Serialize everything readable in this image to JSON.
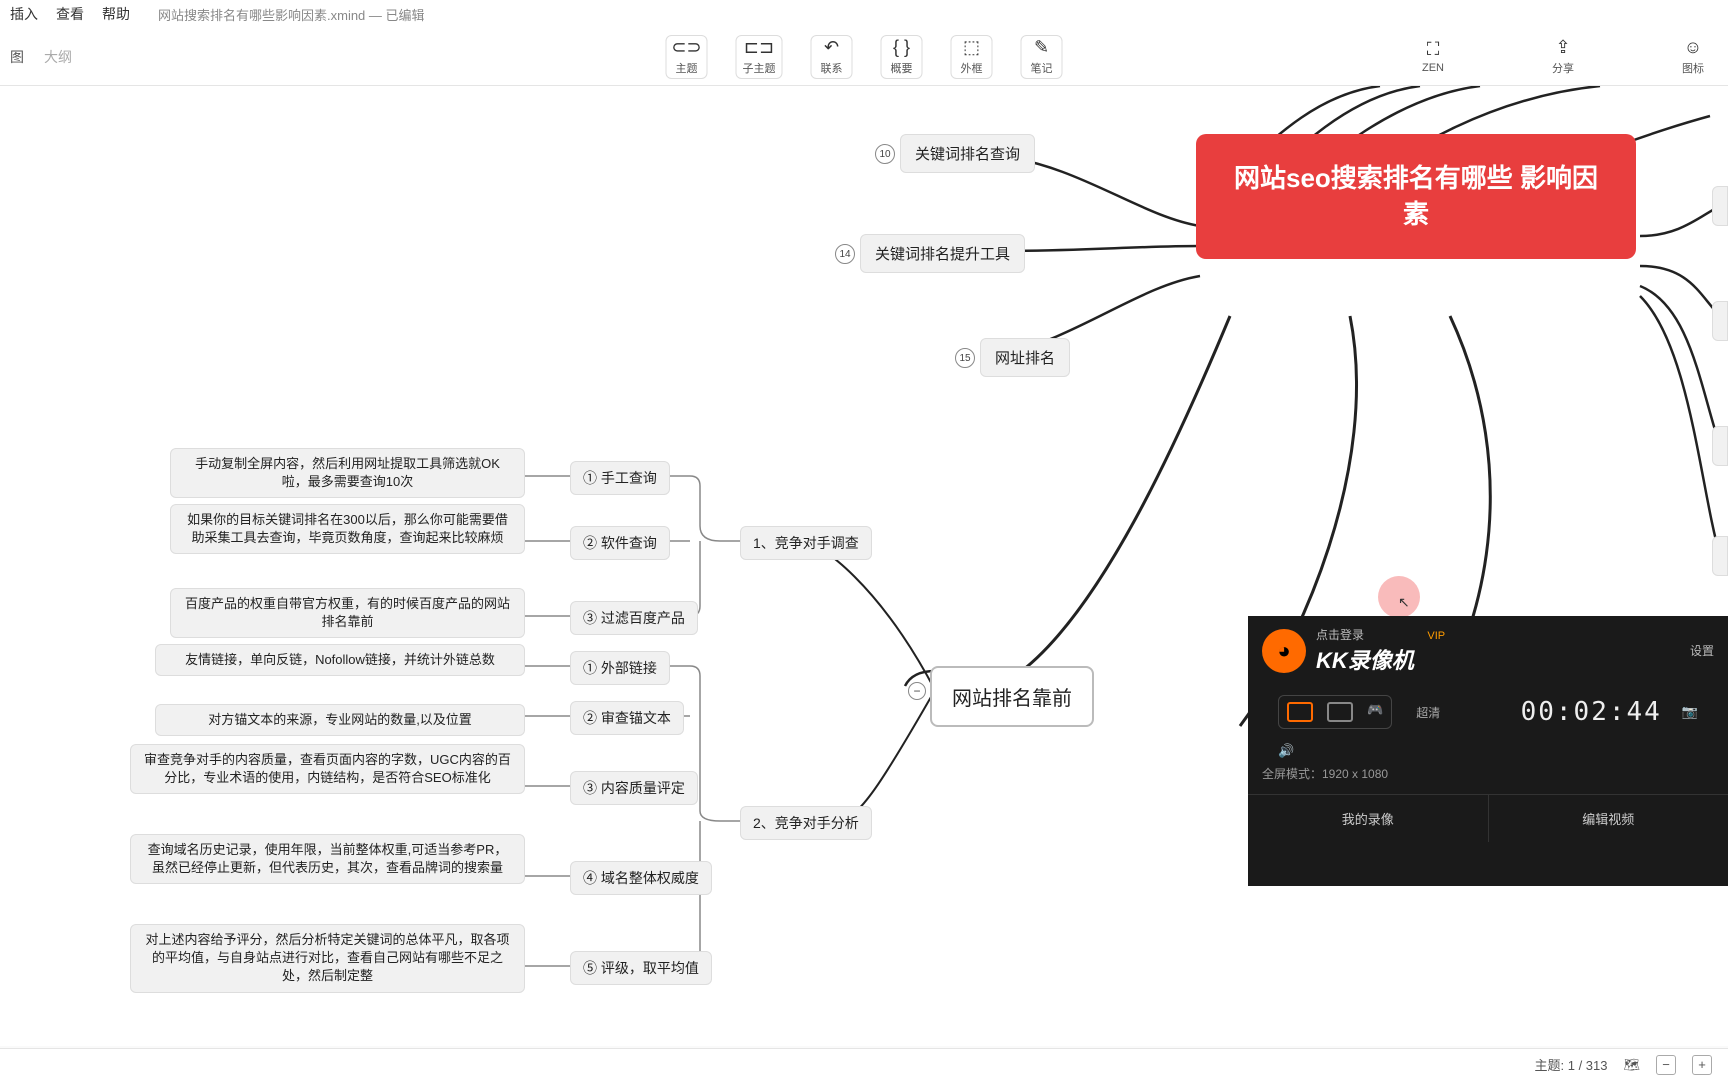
{
  "menu": {
    "items": [
      "插入",
      "查看",
      "帮助"
    ],
    "filename": "网站搜索排名有哪些影响因素.xmind",
    "status": "已编辑"
  },
  "tabs": {
    "graph": "图",
    "outline": "大纲"
  },
  "toolbar": {
    "topic": "主题",
    "subtopic": "子主题",
    "relation": "联系",
    "summary": "概要",
    "boundary": "外框",
    "note": "笔记",
    "zen": "ZEN",
    "share": "分享",
    "icon": "图标"
  },
  "root": "网站seo搜索排名有哪些\n影响因素",
  "sub_main": "网站排名靠前",
  "upper_nodes": [
    {
      "num": "10",
      "label": "关键词排名查询"
    },
    {
      "num": "14",
      "label": "关键词排名提升工具"
    },
    {
      "num": "15",
      "label": "网址排名"
    }
  ],
  "mid_a": {
    "label": "1、竞争对手调查",
    "children": [
      {
        "idx": "① 手工查询",
        "desc": "手动复制全屏内容，然后利用网址提取工具筛选就OK啦，最多需要查询10次"
      },
      {
        "idx": "② 软件查询",
        "desc": "如果你的目标关键词排名在300以后，那么你可能需要借助采集工具去查询，毕竟页数角度，查询起来比较麻烦"
      },
      {
        "idx": "③ 过滤百度产品",
        "desc": "百度产品的权重自带官方权重，有的时候百度产品的网站排名靠前"
      }
    ]
  },
  "mid_b": {
    "label": "2、竞争对手分析",
    "children": [
      {
        "idx": "① 外部链接",
        "desc": "友情链接，单向反链，Nofollow链接，并统计外链总数"
      },
      {
        "idx": "② 审查锚文本",
        "desc": "对方锚文本的来源，专业网站的数量,以及位置"
      },
      {
        "idx": "③ 内容质量评定",
        "desc": "审查竞争对手的内容质量，查看页面内容的字数，UGC内容的百分比，专业术语的使用，内链结构，是否符合SEO标准化"
      },
      {
        "idx": "④ 域名整体权威度",
        "desc": "查询域名历史记录，使用年限，当前整体权重,可适当参考PR，虽然已经停止更新，但代表历史，其次，查看品牌词的搜索量"
      },
      {
        "idx": "⑤ 评级，取平均值",
        "desc": "对上述内容给予评分，然后分析特定关键词的总体平凡，取各项的平均值，与自身站点进行对比，查看自己网站有哪些不足之处，然后制定整"
      }
    ]
  },
  "recorder": {
    "login": "点击登录",
    "vip": "VIP",
    "settings": "设置",
    "brand": "KK录像机",
    "quality": "超清",
    "time": "00:02:44",
    "mode": "全屏模式：1920 x 1080",
    "my": "我的录像",
    "edit": "编辑视频"
  },
  "status": {
    "topics": "主题: 1 / 313"
  }
}
